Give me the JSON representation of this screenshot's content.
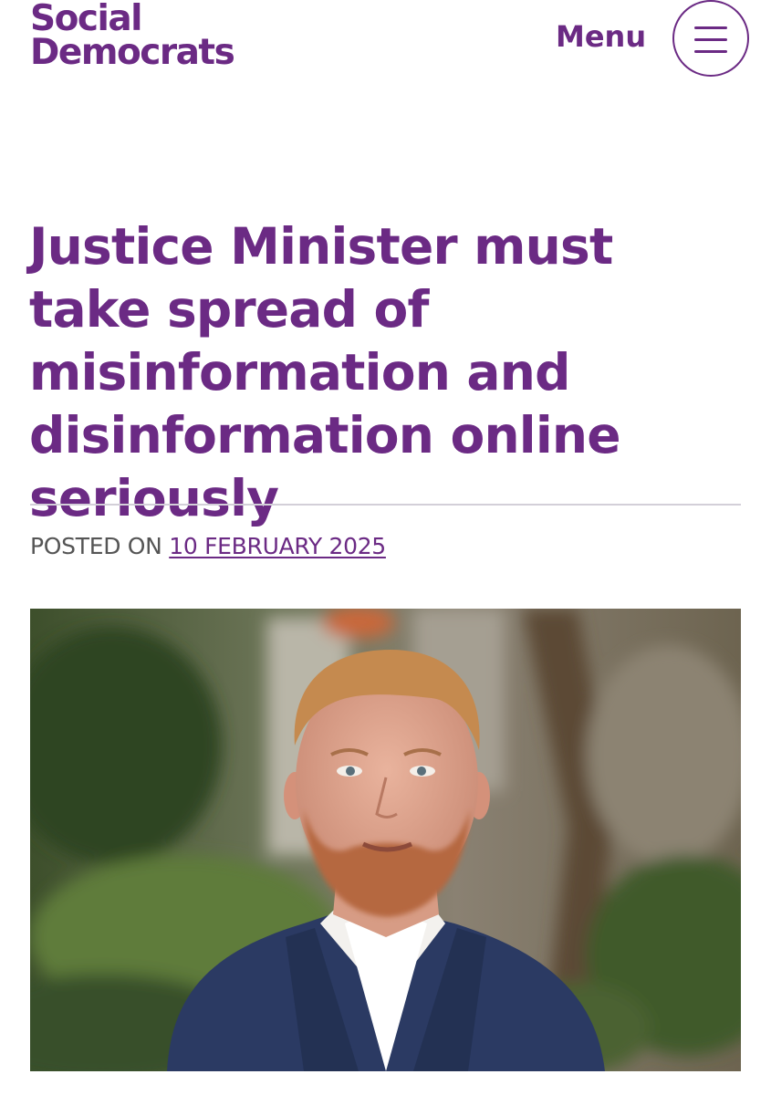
{
  "header": {
    "logo_line1": "Social",
    "logo_line2": "Democrats",
    "menu_label": "Menu",
    "menu_icon": "hamburger-menu-icon"
  },
  "article": {
    "title": "Justice Minister must take spread of misinformation and disinformation online seriously",
    "posted_prefix": "POSTED ON",
    "posted_date": "10 FEBRUARY 2025",
    "featured_image": "portrait photo of a red-haired bearded man in a navy suit jacket and white shirt, outdoors with blurred greenery behind"
  },
  "colors": {
    "brand_purple": "#6b2a84",
    "divider": "#d3cfd8",
    "meta_text": "#555555"
  }
}
